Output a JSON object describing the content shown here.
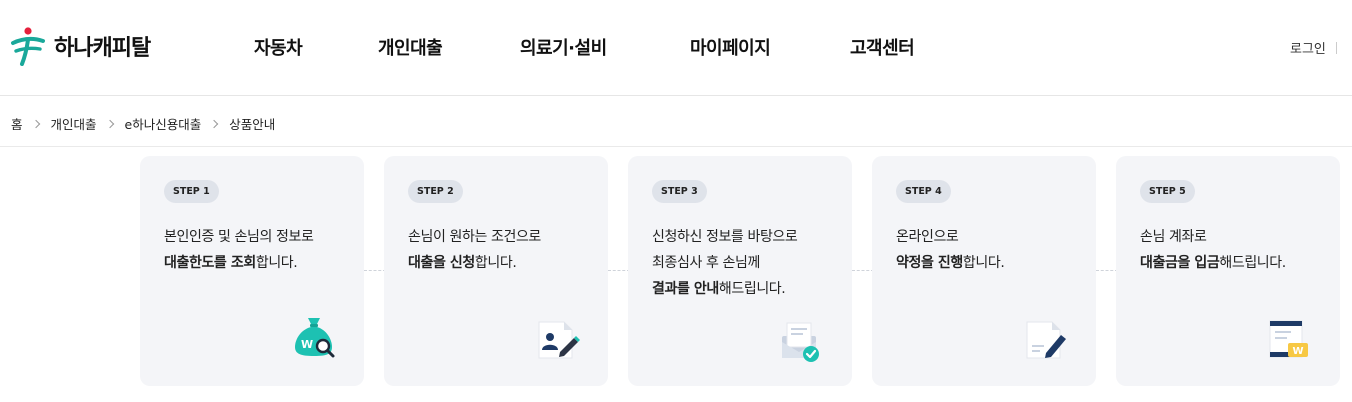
{
  "header": {
    "logo_text": "하나캐피탈",
    "nav": [
      "자동차",
      "개인대출",
      "의료기·설비",
      "마이페이지",
      "고객센터"
    ],
    "login_label": "로그인"
  },
  "breadcrumb": [
    "홈",
    "개인대출",
    "e하나신용대출",
    "상품안내"
  ],
  "steps": [
    {
      "badge": "STEP 1",
      "lines": [
        {
          "pre": "본인인증 및 손님의 정보로",
          "bold": "",
          "post": ""
        },
        {
          "pre": "",
          "bold": "대출한도를 조회",
          "post": "합니다."
        }
      ],
      "icon": "money-bag-search-icon"
    },
    {
      "badge": "STEP 2",
      "lines": [
        {
          "pre": "손님이 원하는 조건으로",
          "bold": "",
          "post": ""
        },
        {
          "pre": "",
          "bold": "대출을 신청",
          "post": "합니다."
        }
      ],
      "icon": "document-profile-pen-icon"
    },
    {
      "badge": "STEP 3",
      "lines": [
        {
          "pre": "신청하신 정보를 바탕으로",
          "bold": "",
          "post": ""
        },
        {
          "pre": "최종심사 후 손님께",
          "bold": "",
          "post": ""
        },
        {
          "pre": "",
          "bold": "결과를 안내",
          "post": "해드립니다."
        }
      ],
      "icon": "mail-check-icon"
    },
    {
      "badge": "STEP 4",
      "lines": [
        {
          "pre": "온라인으로",
          "bold": "",
          "post": ""
        },
        {
          "pre": "",
          "bold": "약정을 진행",
          "post": "합니다."
        }
      ],
      "icon": "document-pen-icon"
    },
    {
      "badge": "STEP 5",
      "lines": [
        {
          "pre": "손님 계좌로",
          "bold": "",
          "post": ""
        },
        {
          "pre": "",
          "bold": "대출금을 입금",
          "post": "해드립니다."
        }
      ],
      "icon": "bankbook-won-icon"
    }
  ],
  "colors": {
    "accent": "#1dc1b2",
    "navy": "#1e3a66",
    "yellow": "#f7c844",
    "brand_red": "#e5203c"
  }
}
